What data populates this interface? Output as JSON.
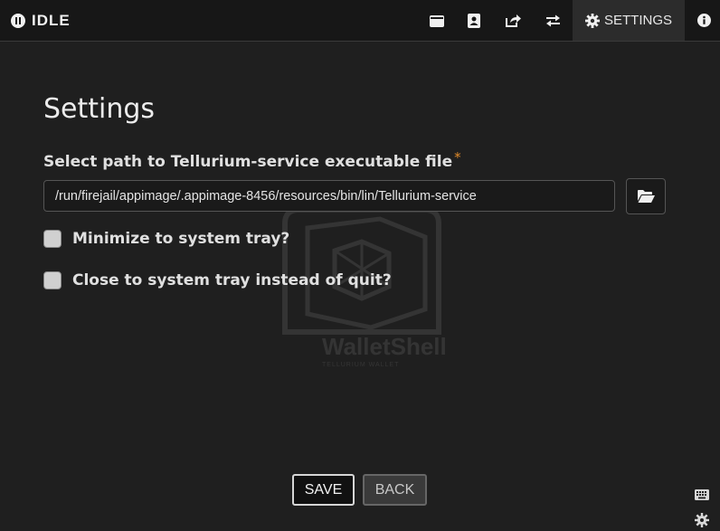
{
  "topbar": {
    "status": "IDLE",
    "settings_label": "SETTINGS",
    "icons": [
      "wallet-icon",
      "address-book-icon",
      "send-icon",
      "transactions-icon",
      "gear-icon",
      "info-icon"
    ]
  },
  "watermark": {
    "brand": "WalletShell",
    "tagline": "TELLURIUM WALLET"
  },
  "settings": {
    "title": "Settings",
    "path_label": "Select path to Tellurium-service executable file",
    "required_mark": "*",
    "path_value": "/run/firejail/appimage/.appimage-8456/resources/bin/lin/Tellurium-service",
    "tray_minimize_label": "Minimize to system tray?",
    "tray_close_label": "Close to system tray instead of quit?",
    "tray_minimize_checked": false,
    "tray_close_checked": false
  },
  "buttons": {
    "save": "SAVE",
    "back": "BACK"
  },
  "colors": {
    "background": "#1f1f1f",
    "topbar": "#171717",
    "required": "#e08a2a"
  }
}
